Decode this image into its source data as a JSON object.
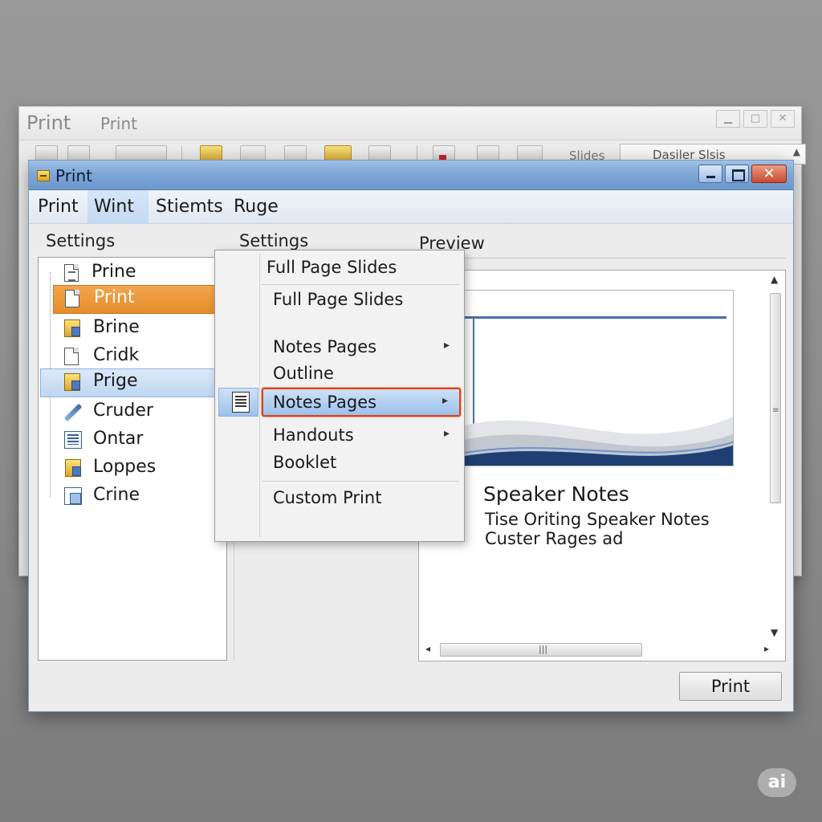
{
  "background_window": {
    "title": "Print",
    "subtitle": "Print",
    "slides_label": "Slides",
    "combo_value": "Dasiler Slsis"
  },
  "dialog": {
    "title": "Print",
    "menu": [
      "Print",
      "Wint",
      "Stiemts",
      "Ruge"
    ],
    "sections": {
      "left": "Settings",
      "middle": "Settings",
      "right": "Preview"
    },
    "tree_items": [
      "Prine",
      "Print",
      "Brine",
      "Cridk",
      "Prige",
      "Cruder",
      "Ontar",
      "Loppes",
      "Crine"
    ],
    "print_button": "Print"
  },
  "dropdown": {
    "header": "Full Page Slides",
    "items": [
      "Full Page Slides",
      "Notes Pages",
      "Outline",
      "Notes Pages",
      "Handouts",
      "Booklet",
      "Custom Print"
    ],
    "submenu_arrow": "▸"
  },
  "preview": {
    "title": "Speaker Notes",
    "lines": [
      "Tise Oriting Speaker Notes",
      "Custer Rages ad"
    ]
  },
  "badge": "ai",
  "colors": {
    "titlebar": "#7ea6d6",
    "selection_orange": "#e58d2c",
    "selection_blue": "#bfd6f1",
    "highlight_border": "#d9461e"
  }
}
